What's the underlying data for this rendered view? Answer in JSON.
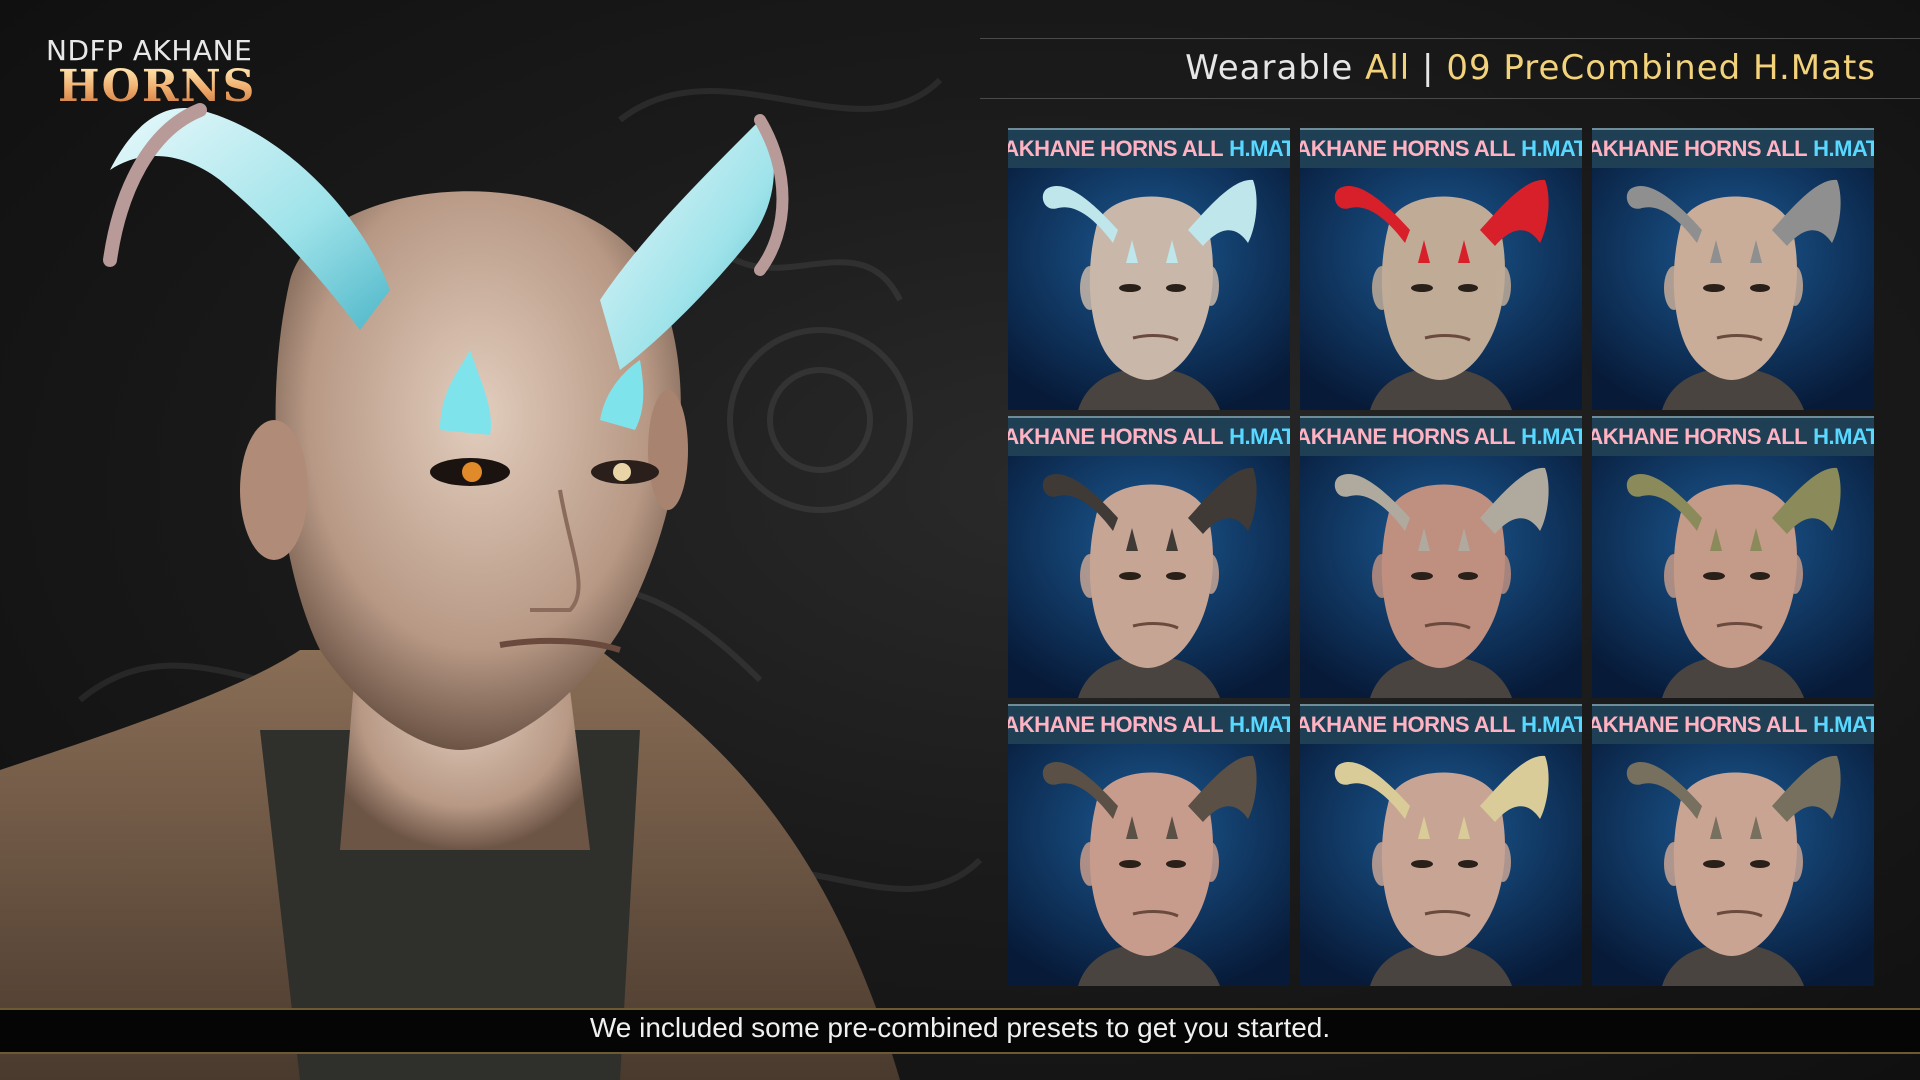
{
  "brand": {
    "line1": "NDFP AKHANE",
    "line2": "HORNS"
  },
  "header": {
    "title_word1": "Wearable",
    "title_word2": "All",
    "title_sep": "|",
    "title_rest": "09 PreCombined H.Mats"
  },
  "tiles": [
    {
      "label_main": "AKHANE HORNS ALL",
      "label_accent": "H.MAT",
      "horn_color": "#bfe6ea",
      "skin_color": "#c9b7a9"
    },
    {
      "label_main": "AKHANE HORNS ALL",
      "label_accent": "H.MAT",
      "horn_color": "#d8202a",
      "skin_color": "#c0ab97"
    },
    {
      "label_main": "AKHANE HORNS ALL",
      "label_accent": "H.MAT",
      "horn_color": "#8f8f8f",
      "skin_color": "#c9ad98"
    },
    {
      "label_main": "AKHANE HORNS ALL",
      "label_accent": "H.MAT",
      "horn_color": "#3f3a36",
      "skin_color": "#c7a595"
    },
    {
      "label_main": "AKHANE HORNS ALL",
      "label_accent": "H.MAT",
      "horn_color": "#b0aa9e",
      "skin_color": "#bf8f80"
    },
    {
      "label_main": "AKHANE HORNS ALL",
      "label_accent": "H.MAT",
      "horn_color": "#8a8a5a",
      "skin_color": "#c49a88"
    },
    {
      "label_main": "AKHANE HORNS ALL",
      "label_accent": "H.MAT",
      "horn_color": "#5b5045",
      "skin_color": "#c89c8c"
    },
    {
      "label_main": "AKHANE HORNS ALL",
      "label_accent": "H.MAT",
      "horn_color": "#d9cc98",
      "skin_color": "#c8a494"
    },
    {
      "label_main": "AKHANE HORNS ALL",
      "label_accent": "H.MAT",
      "horn_color": "#77705f",
      "skin_color": "#c9a493"
    }
  ],
  "footer": {
    "caption": "We included some pre-combined presets to get you started."
  },
  "colors": {
    "gold": "#f2d27a",
    "label_pink": "#ffb3c2",
    "label_blue": "#58d8ff",
    "tile_bg": "#0b2a54"
  }
}
